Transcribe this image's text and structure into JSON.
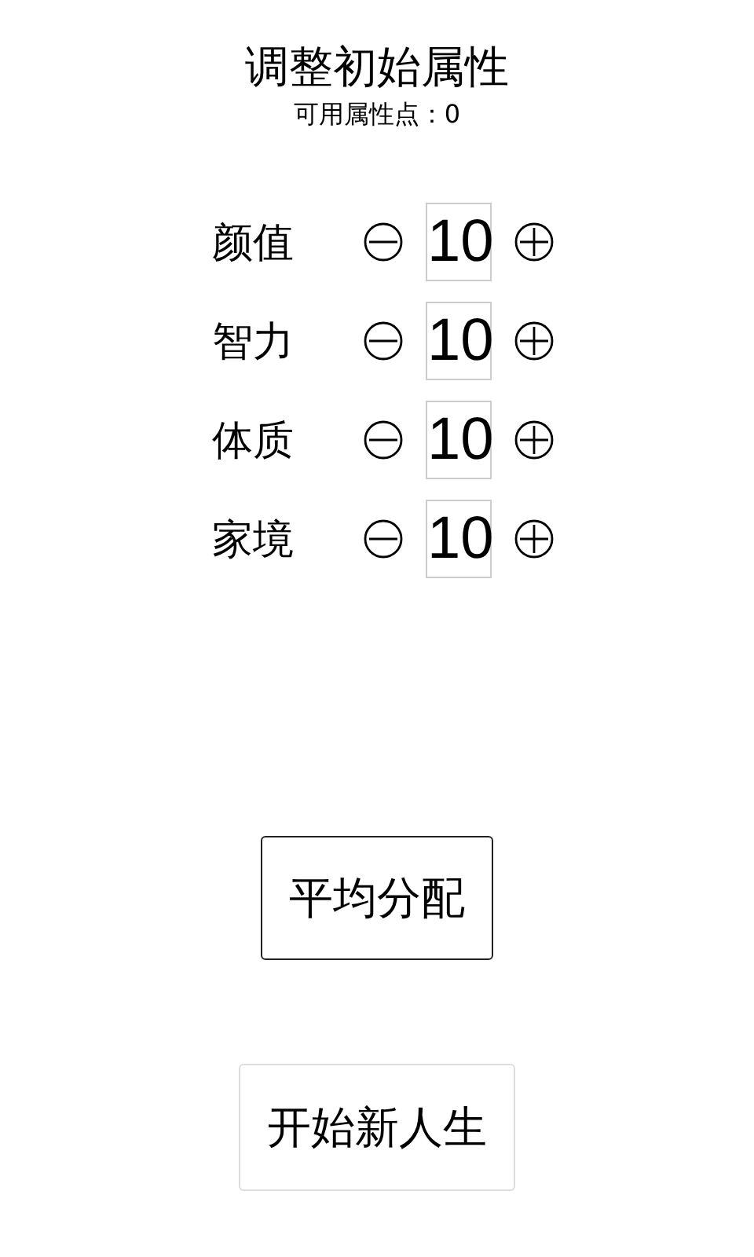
{
  "title": "调整初始属性",
  "points": "可用属性点：0",
  "attributes": [
    {
      "name": "颜值",
      "value": "10"
    },
    {
      "name": "智力",
      "value": "10"
    },
    {
      "name": "体质",
      "value": "10"
    },
    {
      "name": "家境",
      "value": "10"
    }
  ],
  "buttons": [
    {
      "label": "平均分配",
      "kind": "outlined"
    },
    {
      "label": "开始新人生",
      "kind": "plain"
    }
  ]
}
